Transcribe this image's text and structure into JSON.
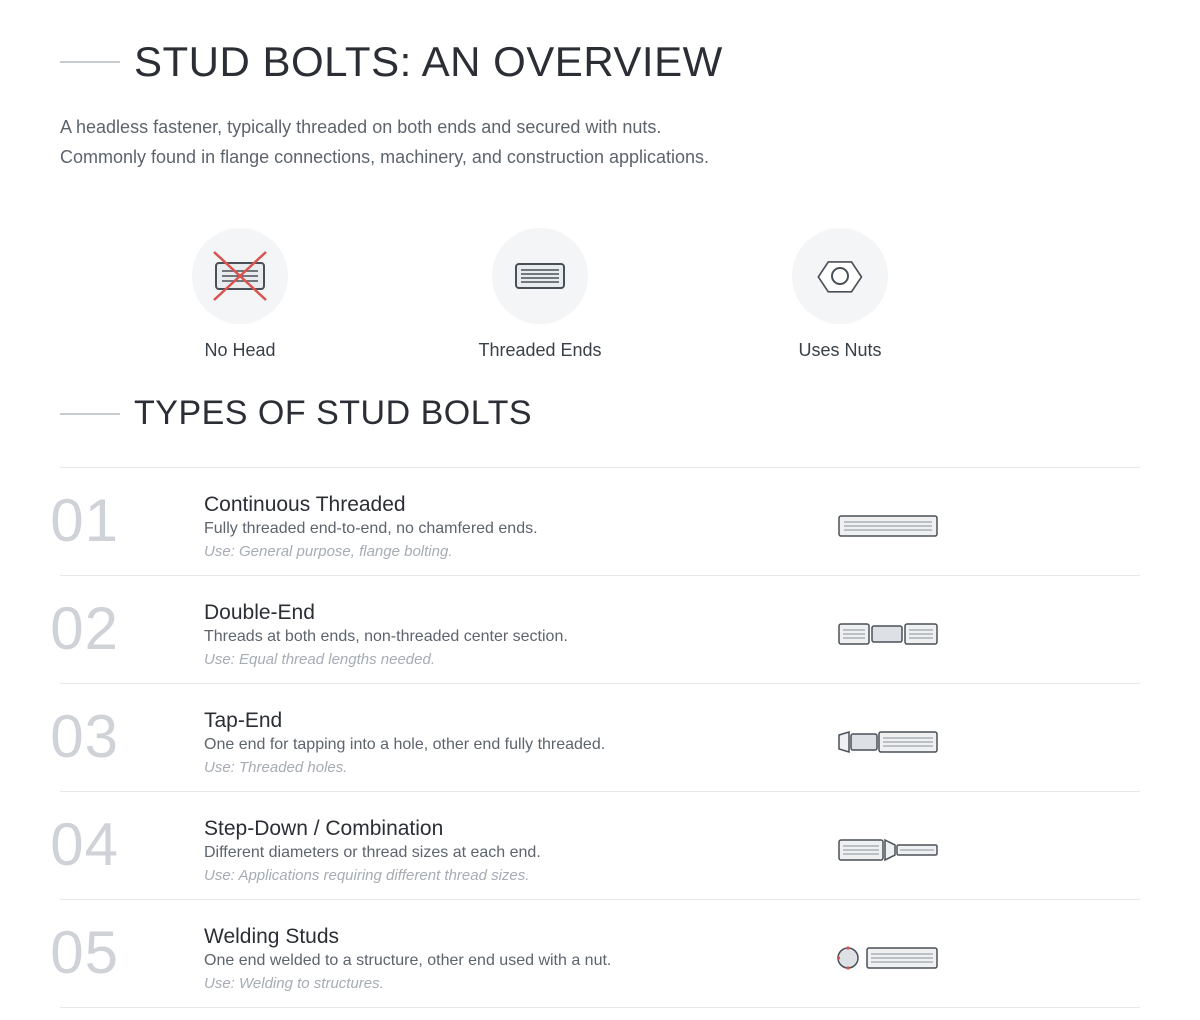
{
  "overview": {
    "title": "STUD BOLTS: AN OVERVIEW",
    "intro_line1": "A headless fastener, typically threaded on both ends and secured with nuts.",
    "intro_line2": "Commonly found in flange connections, machinery, and construction applications."
  },
  "features": [
    {
      "label": "No Head",
      "icon": "no-head-icon"
    },
    {
      "label": "Threaded Ends",
      "icon": "threaded-ends-icon"
    },
    {
      "label": "Uses Nuts",
      "icon": "hex-nut-icon"
    }
  ],
  "types_section": {
    "title": "TYPES OF STUD BOLTS",
    "items": [
      {
        "number": "01",
        "name": "Continuous Threaded",
        "description": "Fully threaded end-to-end, no chamfered ends.",
        "use": "Use: General purpose, flange bolting.",
        "icon": "continuous-threaded-stud-icon"
      },
      {
        "number": "02",
        "name": "Double-End",
        "description": "Threads at both ends, non-threaded center section.",
        "use": "Use: Equal thread lengths needed.",
        "icon": "double-end-stud-icon"
      },
      {
        "number": "03",
        "name": "Tap-End",
        "description": "One end for tapping into a hole, other end fully threaded.",
        "use": "Use: Threaded holes.",
        "icon": "tap-end-stud-icon"
      },
      {
        "number": "04",
        "name": "Step-Down / Combination",
        "description": "Different diameters or thread sizes at each end.",
        "use": "Use: Applications requiring different thread sizes.",
        "icon": "step-down-stud-icon"
      },
      {
        "number": "05",
        "name": "Welding Studs",
        "description": "One end welded to a structure, other end used with a nut.",
        "use": "Use: Welding to structures.",
        "icon": "welding-stud-icon"
      }
    ]
  },
  "colors": {
    "text": "#2b2f35",
    "muted": "#5d646c",
    "faint": "#a6acb3",
    "number": "#cfd3d8",
    "accent_red": "#d9534f",
    "icon_stroke": "#4a5058",
    "icon_fill": "#e9ecef"
  }
}
